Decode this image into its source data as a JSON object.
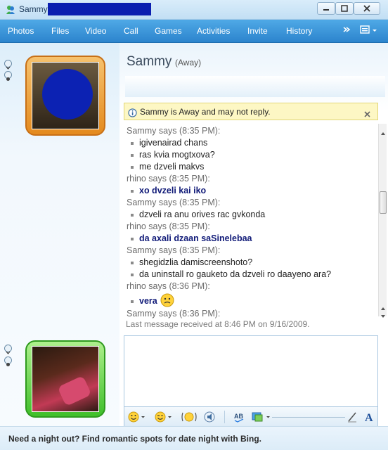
{
  "window": {
    "title": "Sammy"
  },
  "menu": {
    "items": [
      "Photos",
      "Files",
      "Video",
      "Call",
      "Games",
      "Activities",
      "Invite",
      "History"
    ],
    "overflow_icon": "double-chevron-right-icon"
  },
  "contact": {
    "name": "Sammy",
    "status": "(Away)"
  },
  "notice": {
    "text": "Sammy is Away and may not reply."
  },
  "conversation": [
    {
      "type": "header",
      "text": "Sammy says (8:35 PM):"
    },
    {
      "type": "msg",
      "text": "igivenairad chans",
      "bold": false
    },
    {
      "type": "msg",
      "text": "ras kvia mogtxova?",
      "bold": false
    },
    {
      "type": "msg",
      "text": "me dzveli makvs",
      "bold": false
    },
    {
      "type": "header",
      "text": "rhino says (8:35 PM):"
    },
    {
      "type": "msg",
      "text": "xo dvzeli kai iko",
      "bold": true
    },
    {
      "type": "header",
      "text": "Sammy says (8:35 PM):"
    },
    {
      "type": "msg",
      "text": "dzveli ra anu orives rac gvkonda",
      "bold": false
    },
    {
      "type": "header",
      "text": "rhino says (8:35 PM):"
    },
    {
      "type": "msg",
      "text": "da axali dzaan saSinelebaa",
      "bold": true
    },
    {
      "type": "header",
      "text": "Sammy says (8:35 PM):"
    },
    {
      "type": "msg",
      "text": "shegidzlia damiscreenshoto?",
      "bold": false
    },
    {
      "type": "msg",
      "text": "da uninstall ro gauketo da dzveli ro daayeno ara?",
      "bold": false
    },
    {
      "type": "header",
      "text": "rhino says (8:36 PM):"
    },
    {
      "type": "msg",
      "text": "vera",
      "bold": true,
      "emoticon": "confused-face-icon"
    },
    {
      "type": "header",
      "text": "Sammy says (8:36 PM):"
    }
  ],
  "last_message": "Last message received at 8:46 PM on 9/16/2009.",
  "ad": {
    "text": "Need a night out? Find romantic spots for date night with Bing."
  },
  "colors": {
    "menu_bar": "#2c84cd",
    "notice_bg": "#fdf7c4",
    "own_message": "#101a78",
    "redaction": "#0a1eb0"
  }
}
